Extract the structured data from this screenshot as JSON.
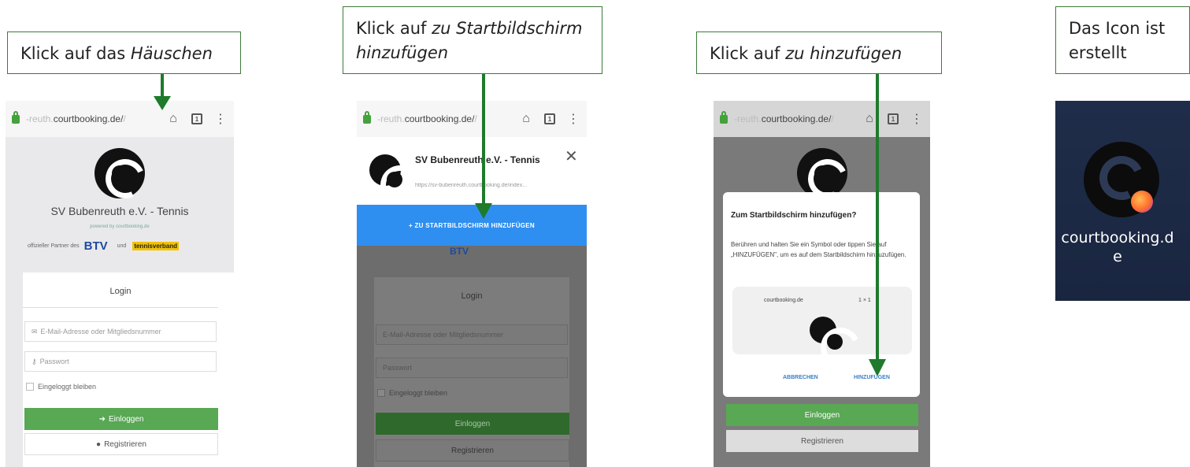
{
  "steps": [
    {
      "pre": "Klick auf das ",
      "em": "Häuschen"
    },
    {
      "pre": "Klick auf ",
      "em": "zu Startbildschirm hinzufügen"
    },
    {
      "pre": "Klick auf ",
      "em": "zu hinzufügen"
    },
    {
      "text": "Das Icon ist erstellt"
    }
  ],
  "screen1": {
    "url_prefix": "-reuth.",
    "url_main": "courtbooking.de/",
    "url_suffix": "/",
    "tab_count": "1",
    "club_name": "SV Bubenreuth e.V. - Tennis",
    "powered_by": "powered by courtbooking.de",
    "partner_text": "offizieller Partner des",
    "btv": "BTV",
    "and": "und",
    "tennisverband": "tennisverband",
    "login_title": "Login",
    "email_placeholder": "E-Mail-Adresse oder Mitgliedsnummer",
    "password_placeholder": "Passwort",
    "stay_logged_in": "Eingeloggt bleiben",
    "login_button": "Einloggen",
    "register_button": "Registrieren"
  },
  "screen2": {
    "url_prefix": "-reuth.",
    "url_main": "courtbooking.de/",
    "url_suffix": "/",
    "tab_count": "1",
    "site_title": "SV Bubenreuth e.V. - Tennis",
    "site_url": "https://sv-bubenreuth.courtbooking.de/index...",
    "add_button": "+ ZU STARTBILDSCHIRM HINZUFÜGEN",
    "login_title": "Login",
    "email_placeholder": "E-Mail-Adresse oder Mitgliedsnummer",
    "password_placeholder": "Passwort",
    "stay_logged_in": "Eingeloggt bleiben",
    "login_button": "Einloggen",
    "register_button": "Registrieren"
  },
  "screen3": {
    "url_prefix": "-reuth.",
    "url_main": "courtbooking.de/",
    "url_suffix": "/",
    "tab_count": "1",
    "dialog_title": "Zum Startbildschirm hinzufügen?",
    "dialog_body": "Berühren und halten Sie ein Symbol oder tippen Sie auf „HINZUFÜGEN\", um es auf dem Startbildschirm hinzuzufügen.",
    "preview_label": "courtbooking.de",
    "preview_size": "1 × 1",
    "cancel": "ABBRECHEN",
    "add": "HINZUFÜGEN",
    "login_button": "Einloggen",
    "register_button": "Registrieren"
  },
  "screen4": {
    "icon_label": "courtbooking.de"
  },
  "colors": {
    "arrow": "#1f7a2c",
    "callout_border": "#3d7a3a",
    "blue_bar": "#2f8ff0",
    "login_green": "#58a854",
    "dialog_accent": "#3b7fc4",
    "home_bg": "#1d2a44"
  }
}
